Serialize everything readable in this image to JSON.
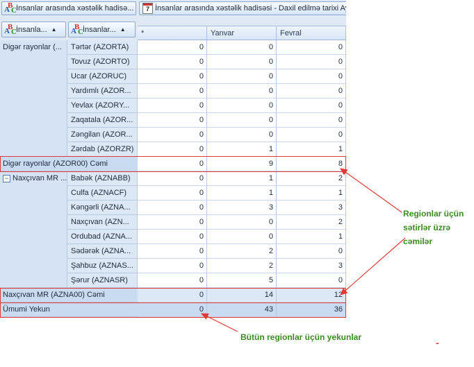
{
  "filter_bar": {
    "field1_label": "İnsanlar arasında xəstəlik hadisə...",
    "field2_label": "İnsanlar arasında xəstəlik hadisəsi - Daxil edilmə tarixi Ay",
    "calendar_digit": "7"
  },
  "row_headers": {
    "h1": "İnsanla...",
    "h2": "İnsanlar...",
    "sort_glyph": "▲"
  },
  "columns": [
    "*",
    "Yanvar",
    "Fevral"
  ],
  "groups": [
    {
      "label": "Digər rayonlar (...",
      "rows": [
        {
          "name": "Tərtər (AZORTA)",
          "values": [
            "0",
            "0",
            "0"
          ]
        },
        {
          "name": "Tovuz (AZORTO)",
          "values": [
            "0",
            "0",
            "0"
          ]
        },
        {
          "name": "Ucar (AZORUC)",
          "values": [
            "0",
            "0",
            "0"
          ]
        },
        {
          "name": "Yardımlı (AZOR...",
          "values": [
            "0",
            "0",
            "0"
          ]
        },
        {
          "name": "Yevlax (AZORY...",
          "values": [
            "0",
            "0",
            "0"
          ]
        },
        {
          "name": "Zaqatala (AZOR...",
          "values": [
            "0",
            "0",
            "0"
          ]
        },
        {
          "name": "Zəngilan (AZOR...",
          "values": [
            "0",
            "0",
            "0"
          ]
        },
        {
          "name": "Zərdab (AZORZR)",
          "values": [
            "0",
            "1",
            "1"
          ]
        }
      ],
      "total": {
        "label": "Digər rayonlar (AZOR00) Cəmi",
        "values": [
          "0",
          "9",
          "8"
        ]
      }
    },
    {
      "label": "Naxçıvan MR ...",
      "collapse_glyph": "−",
      "rows": [
        {
          "name": "Babək (AZNABB)",
          "values": [
            "0",
            "1",
            "2"
          ]
        },
        {
          "name": "Culfa (AZNACF)",
          "values": [
            "0",
            "1",
            "1"
          ]
        },
        {
          "name": "Kəngərli (AZNA...",
          "values": [
            "0",
            "3",
            "3"
          ]
        },
        {
          "name": "Naxçıvan (AZN...",
          "values": [
            "0",
            "0",
            "2"
          ]
        },
        {
          "name": "Ordubad (AZNA...",
          "values": [
            "0",
            "0",
            "1"
          ]
        },
        {
          "name": "Sədərək (AZNA...",
          "values": [
            "0",
            "2",
            "0"
          ]
        },
        {
          "name": "Şahbuz (AZNAS...",
          "values": [
            "0",
            "2",
            "3"
          ]
        },
        {
          "name": "Şərur (AZNASR)",
          "values": [
            "0",
            "5",
            "0"
          ]
        }
      ],
      "total": {
        "label": "Naxçıvan MR (AZNA00) Cəmi",
        "values": [
          "0",
          "14",
          "12"
        ]
      }
    }
  ],
  "grand_total": {
    "label": "Ümumi Yekun",
    "values": [
      "0",
      "43",
      "36"
    ]
  },
  "annotations": {
    "regional_line1": "Regionlar üçün",
    "regional_line2": "sətirlər üzrə",
    "regional_line3": "cəmilər",
    "overall": "Bütün regionlar üçün yekunlar",
    "dash": "-"
  },
  "colors": {
    "highlight_box": "#e23838",
    "annotation_text": "#3c8a22",
    "header_blue": "#d9e6f6"
  }
}
